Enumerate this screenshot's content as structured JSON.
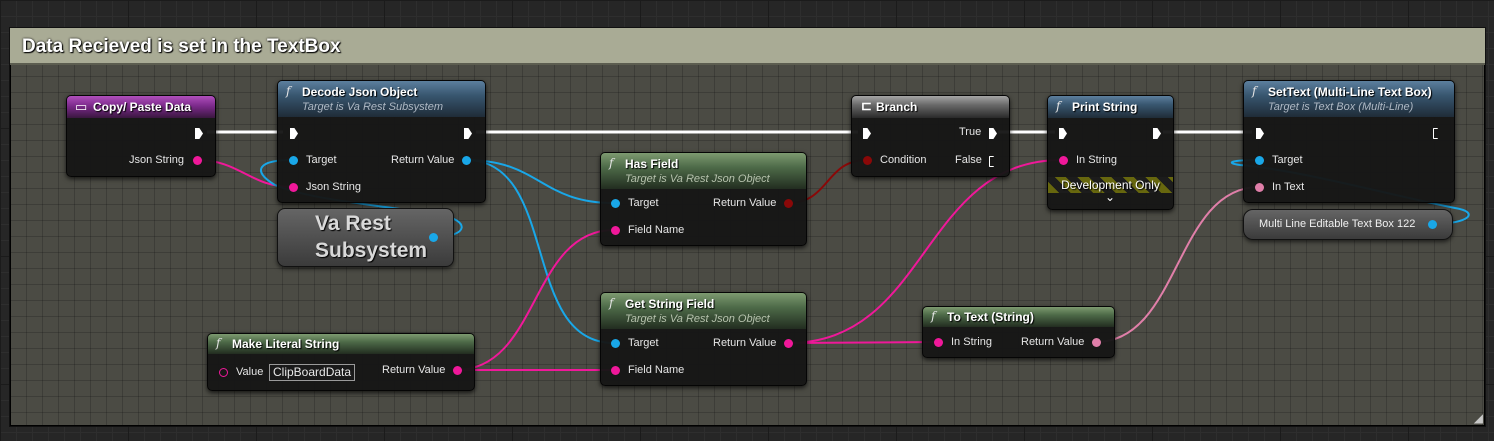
{
  "comment": {
    "title": "Data Recieved is set in the TextBox"
  },
  "icons": {
    "function": "f",
    "event": "▭",
    "branch": "⊏",
    "chevron": "⌄",
    "grip": "◢"
  },
  "nodes": {
    "copy_paste": {
      "title": "Copy/ Paste Data",
      "pins": {
        "json_string": "Json String"
      }
    },
    "decode_json": {
      "title": "Decode Json Object",
      "subtitle": "Target is Va Rest Subsystem",
      "pins": {
        "target": "Target",
        "json_string": "Json String",
        "return_value": "Return Value"
      }
    },
    "va_rest": {
      "label_line1": "Va Rest",
      "label_line2": "Subsystem"
    },
    "make_literal": {
      "title": "Make Literal String",
      "pins": {
        "value": "Value",
        "value_text": "ClipBoardData",
        "return_value": "Return Value"
      }
    },
    "has_field": {
      "title": "Has Field",
      "subtitle": "Target is Va Rest Json Object",
      "pins": {
        "target": "Target",
        "field_name": "Field Name",
        "return_value": "Return Value"
      }
    },
    "get_string_field": {
      "title": "Get String Field",
      "subtitle": "Target is Va Rest Json Object",
      "pins": {
        "target": "Target",
        "field_name": "Field Name",
        "return_value": "Return Value"
      }
    },
    "branch": {
      "title": "Branch",
      "pins": {
        "condition": "Condition",
        "true": "True",
        "false": "False"
      }
    },
    "print_string": {
      "title": "Print String",
      "pins": {
        "in_string": "In String"
      },
      "dev_only": "Development Only"
    },
    "to_text": {
      "title": "To Text (String)",
      "pins": {
        "in_string": "In String",
        "return_value": "Return Value"
      }
    },
    "set_text": {
      "title": "SetText (Multi-Line Text Box)",
      "subtitle": "Target is Text Box (Multi-Line)",
      "pins": {
        "target": "Target",
        "in_text": "In Text"
      }
    },
    "text_box_var": {
      "label": "Multi Line Editable Text Box 122"
    }
  },
  "colors": {
    "exec": "#ffffff",
    "object": "#19a7e8",
    "string": "#f0189a",
    "text": "#e07fa9",
    "boolean": "#8a0808"
  }
}
